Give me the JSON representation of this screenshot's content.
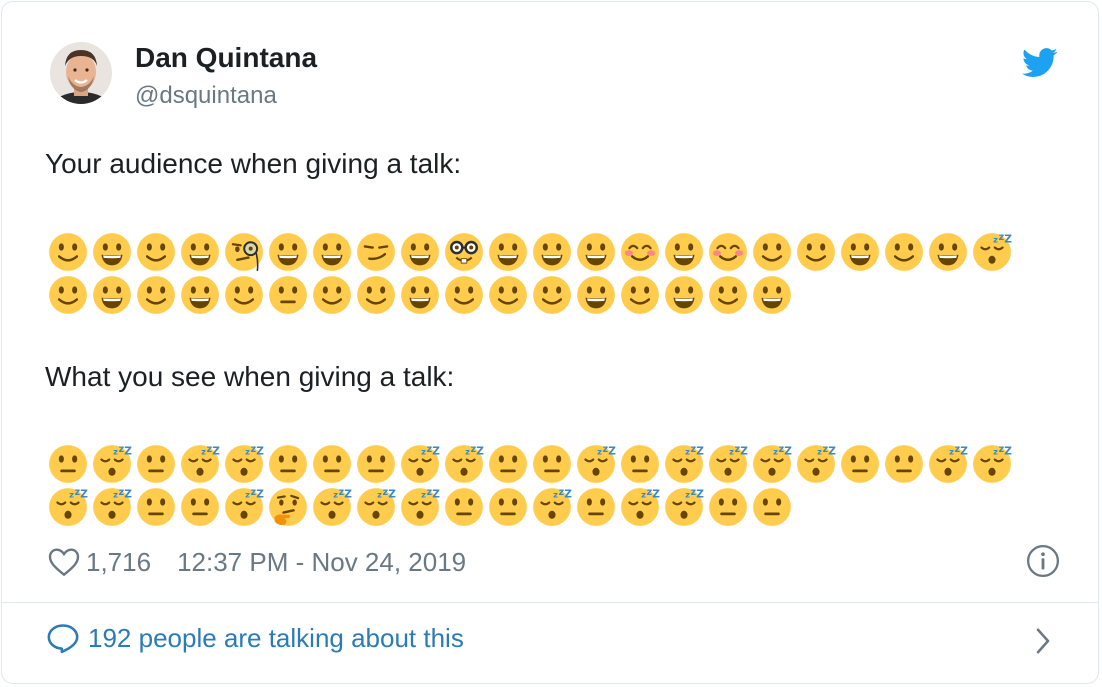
{
  "tweet": {
    "author_name": "Dan Quintana",
    "author_handle": "@dsquintana",
    "line1": "Your audience when giving a talk:",
    "line2": "What you see when giving a talk:",
    "audience_rows": [
      [
        "smile",
        "grin",
        "smile",
        "grin",
        "monocle",
        "grin",
        "grin",
        "smirk",
        "grin",
        "nerd",
        "grin",
        "grin",
        "grin",
        "blush",
        "grin",
        "blush",
        "smile",
        "smile",
        "grin",
        "smile",
        "grin",
        "sleeping"
      ],
      [
        "smile",
        "grin",
        "smile",
        "grin",
        "smile",
        "neutral",
        "smile",
        "smile",
        "grin",
        "smile",
        "smile",
        "smile",
        "grin",
        "smile",
        "grin",
        "smile",
        "grin"
      ]
    ],
    "seen_rows": [
      [
        "neutral",
        "sleeping",
        "neutral",
        "sleeping",
        "sleeping",
        "neutral",
        "neutral",
        "neutral",
        "sleeping",
        "sleeping",
        "neutral",
        "neutral",
        "sleeping",
        "neutral",
        "sleeping",
        "sleeping",
        "sleeping",
        "sleeping",
        "neutral",
        "neutral",
        "sleeping",
        "sleeping"
      ],
      [
        "sleeping",
        "sleeping",
        "neutral",
        "neutral",
        "sleeping",
        "thinking",
        "sleeping",
        "sleeping",
        "sleeping",
        "neutral",
        "neutral",
        "sleeping",
        "neutral",
        "sleeping",
        "sleeping",
        "neutral",
        "neutral"
      ]
    ],
    "likes": "1,716",
    "timestamp": "12:37 PM - Nov 24, 2019",
    "talking": "192 people are talking about this"
  },
  "icons": {
    "brand": "twitter-bird-icon",
    "like": "heart-icon",
    "info": "info-icon",
    "reply": "speech-bubble-icon",
    "more": "chevron-right-icon"
  },
  "colors": {
    "twitter_blue": "#1da1f2",
    "link_blue": "#2b7bb9",
    "meta_gray": "#697882",
    "emoji_yellow": "#ffcc4d",
    "emoji_features": "#664500",
    "blush": "#ff7892"
  }
}
